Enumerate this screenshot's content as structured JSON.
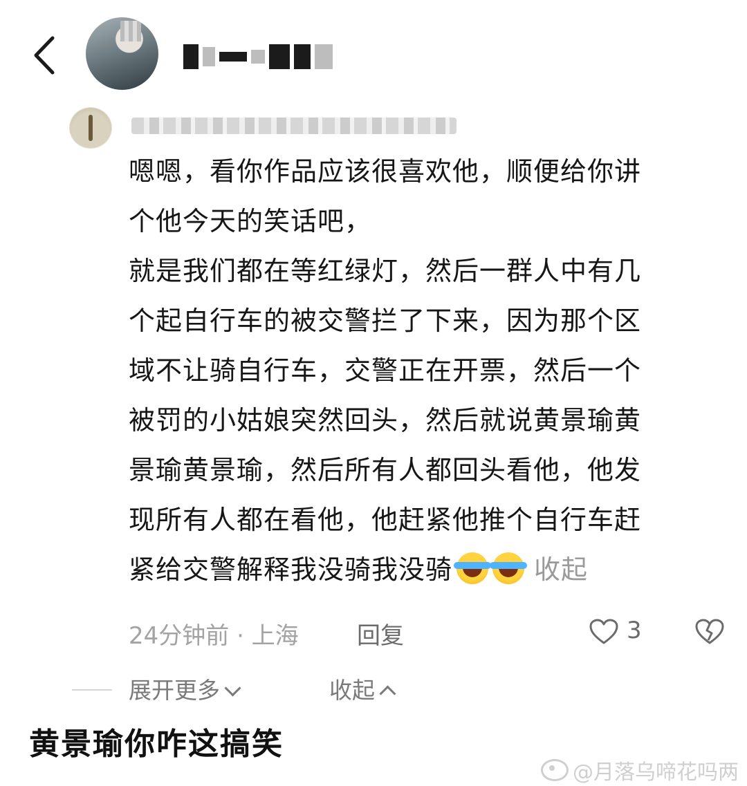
{
  "header": {
    "back_icon": "chevron-left-icon"
  },
  "comment": {
    "lines": [
      "嗯嗯，看你作品应该很喜欢他，顺便给你讲",
      "个他今天的笑话吧，",
      "就是我们都在等红绿灯，然后一群人中有几",
      "个起自行车的被交警拦了下来，因为那个区",
      "域不让骑自行车，交警正在开票，然后一个",
      "被罚的小姑娘突然回头，然后就说黄景瑜黄",
      "景瑜黄景瑜，然后所有人都回头看他，他发",
      "现所有人都在看他，他赶紧他推个自行车赶",
      "紧给交警解释我没骑我没骑"
    ],
    "emojis": [
      "laugh-cry-emoji",
      "laugh-cry-emoji"
    ],
    "collapse_inline": "收起",
    "time_location": "24分钟前 · 上海",
    "reply_label": "回复",
    "like_count": "3"
  },
  "thread_controls": {
    "expand_more": "展开更多",
    "collapse": "收起"
  },
  "caption": "黄景瑜你咋这搞笑",
  "watermark": "@月落乌啼花吗两"
}
